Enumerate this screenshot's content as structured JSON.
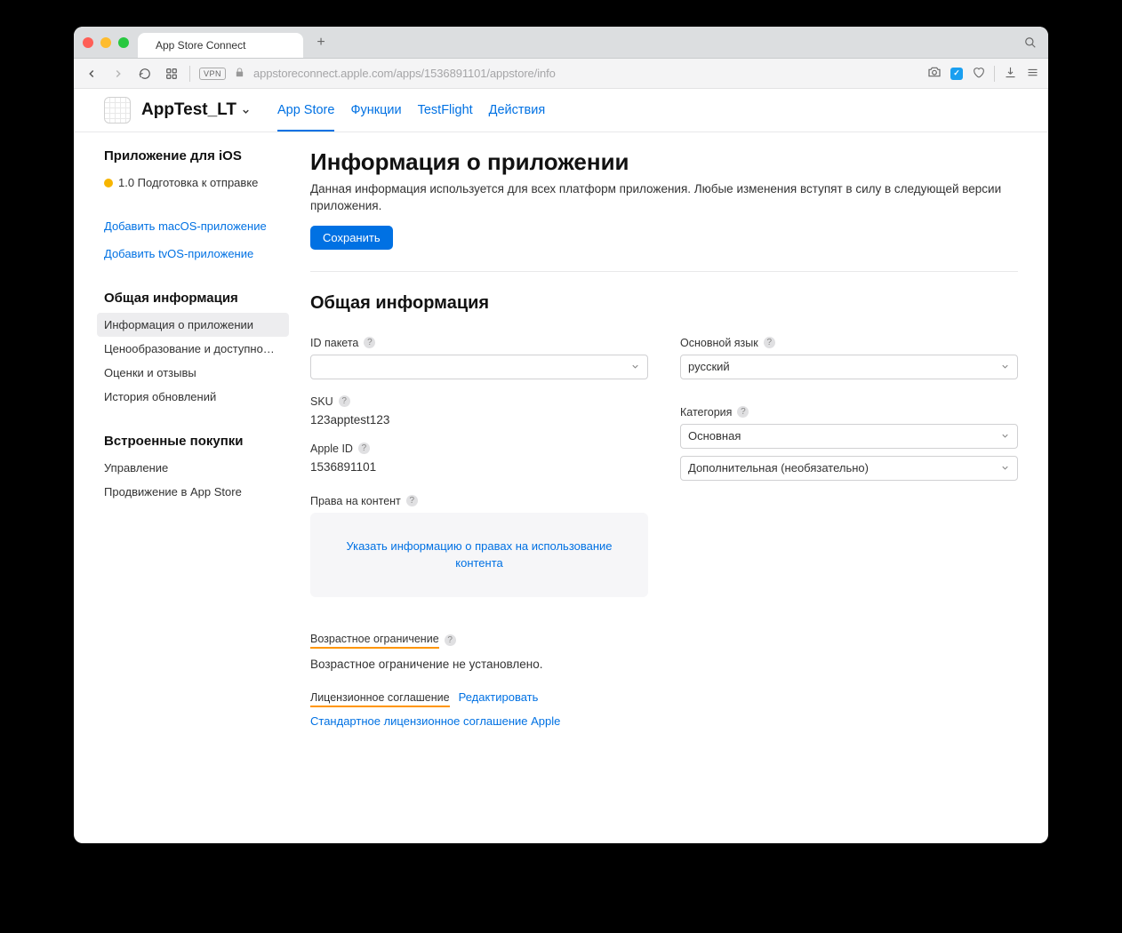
{
  "browser": {
    "tab_title": "App Store Connect",
    "url": "appstoreconnect.apple.com/apps/1536891101/appstore/info"
  },
  "header": {
    "app_name": "AppTest_LT",
    "tabs": [
      "App Store",
      "Функции",
      "TestFlight",
      "Действия"
    ]
  },
  "sidebar": {
    "section1_title": "Приложение для iOS",
    "version_status": "1.0 Подготовка к отправке",
    "add_macos": "Добавить macOS-приложение",
    "add_tvos": "Добавить tvOS-приложение",
    "section2_title": "Общая информация",
    "items2": [
      "Информация о приложении",
      "Ценообразование и доступно…",
      "Оценки и отзывы",
      "История обновлений"
    ],
    "section3_title": "Встроенные покупки",
    "items3": [
      "Управление",
      "Продвижение в App Store"
    ]
  },
  "main": {
    "title": "Информация о приложении",
    "subtitle": "Данная информация используется для всех платформ приложения. Любые изменения вступят в силу в следующей версии приложения.",
    "save": "Сохранить",
    "section_title": "Общая информация",
    "labels": {
      "bundle_id": "ID пакета",
      "sku": "SKU",
      "apple_id": "Apple ID",
      "content_rights": "Права на контент",
      "age_rating": "Возрастное ограничение",
      "license": "Лицензионное соглашение",
      "primary_lang": "Основной язык",
      "category": "Категория"
    },
    "values": {
      "sku": "123apptest123",
      "apple_id": "1536891101",
      "primary_lang": "русский",
      "category_primary": "Основная",
      "category_secondary": "Дополнительная (необязательно)",
      "age_rating_value": "Возрастное ограничение не установлено."
    },
    "links": {
      "content_rights": "Указать информацию о правах на использование контента",
      "edit": "Редактировать",
      "std_license": "Стандартное лицензионное соглашение Apple"
    }
  }
}
